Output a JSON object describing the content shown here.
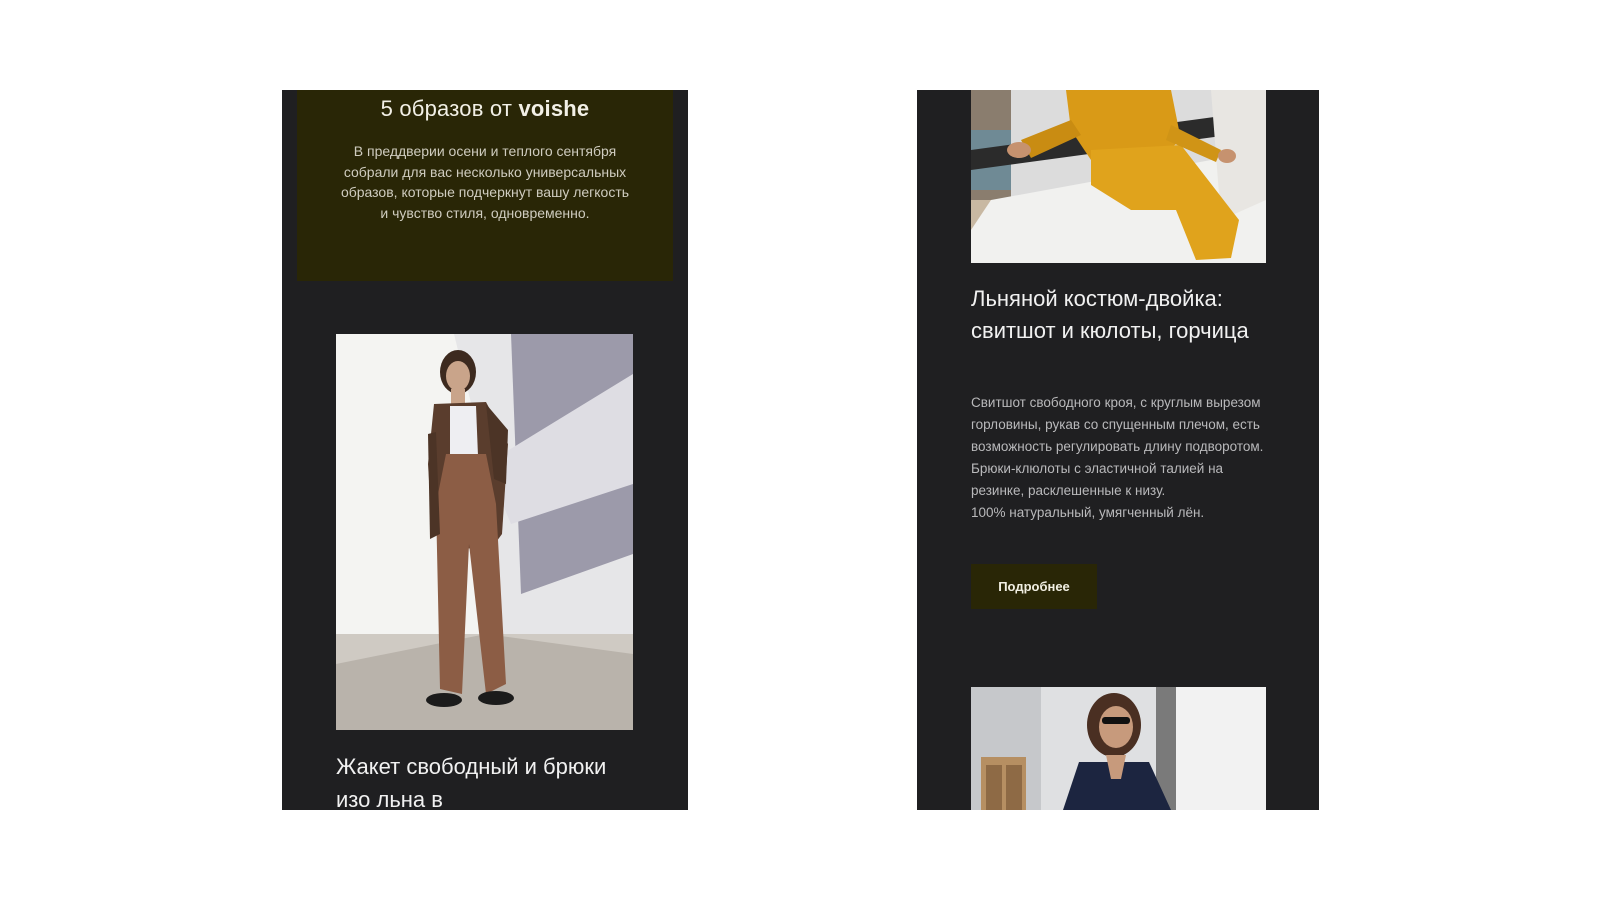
{
  "left_screen": {
    "intro": {
      "title_prefix": "5 образов от ",
      "title_brand": "voishe",
      "text": "В преддверии осени и теплого сентября собрали для вас несколько универсальных образов, которые подчеркнут вашу легкость и чувство стиля, одновременно."
    },
    "card": {
      "title": "Жакет свободный и брюки изо льна в"
    }
  },
  "right_screen": {
    "card": {
      "title": "Льняной костюм-двойка: свитшот и кюлоты, горчица",
      "description": "Свитшот свободного кроя, с круглым вырезом горловины, рукав со спущенным плечом, есть возможность регулировать длину подворотом. Брюки-клюлоты с эластичной талией на резинке, расклешенные к низу.",
      "material": "100% натуральный, умягченный лён.",
      "button_label": "Подробнее"
    }
  },
  "colors": {
    "panel_bg": "#1f1f21",
    "accent_olive": "#292606",
    "page_bg": "#ffffff"
  }
}
